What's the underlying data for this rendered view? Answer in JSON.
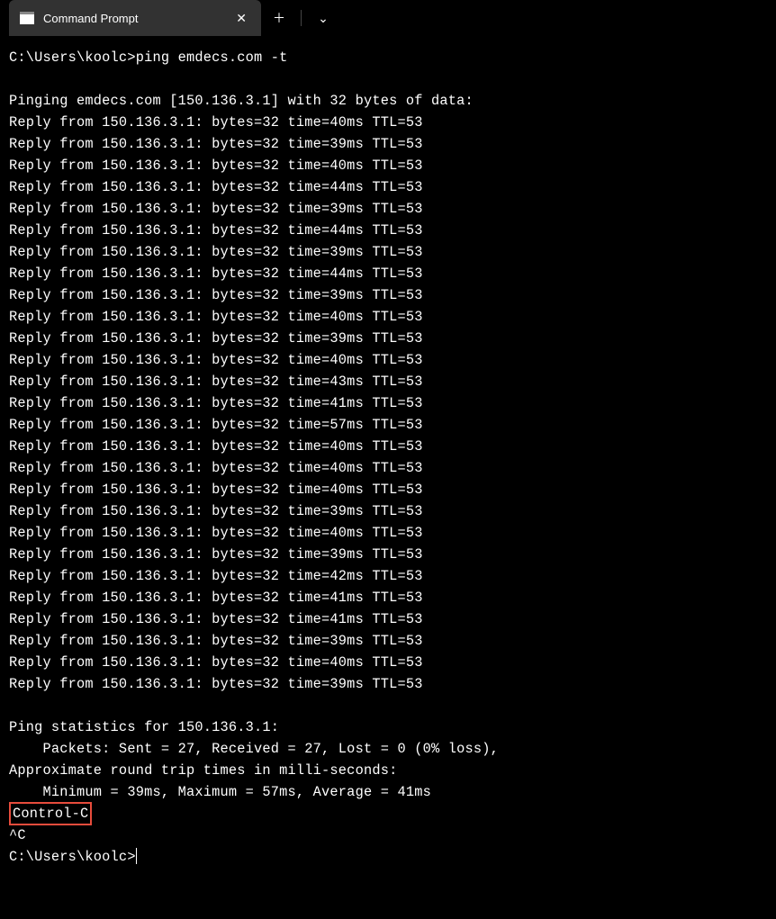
{
  "titlebar": {
    "tab_title": "Command Prompt",
    "close_label": "✕",
    "new_tab_label": "＋",
    "dropdown_label": "⌄"
  },
  "terminal": {
    "prompt1": "C:\\Users\\koolc>",
    "command1": "ping emdecs.com -t",
    "blank": "",
    "ping_header": "Pinging emdecs.com [150.136.3.1] with 32 bytes of data:",
    "replies": [
      "Reply from 150.136.3.1: bytes=32 time=40ms TTL=53",
      "Reply from 150.136.3.1: bytes=32 time=39ms TTL=53",
      "Reply from 150.136.3.1: bytes=32 time=40ms TTL=53",
      "Reply from 150.136.3.1: bytes=32 time=44ms TTL=53",
      "Reply from 150.136.3.1: bytes=32 time=39ms TTL=53",
      "Reply from 150.136.3.1: bytes=32 time=44ms TTL=53",
      "Reply from 150.136.3.1: bytes=32 time=39ms TTL=53",
      "Reply from 150.136.3.1: bytes=32 time=44ms TTL=53",
      "Reply from 150.136.3.1: bytes=32 time=39ms TTL=53",
      "Reply from 150.136.3.1: bytes=32 time=40ms TTL=53",
      "Reply from 150.136.3.1: bytes=32 time=39ms TTL=53",
      "Reply from 150.136.3.1: bytes=32 time=40ms TTL=53",
      "Reply from 150.136.3.1: bytes=32 time=43ms TTL=53",
      "Reply from 150.136.3.1: bytes=32 time=41ms TTL=53",
      "Reply from 150.136.3.1: bytes=32 time=57ms TTL=53",
      "Reply from 150.136.3.1: bytes=32 time=40ms TTL=53",
      "Reply from 150.136.3.1: bytes=32 time=40ms TTL=53",
      "Reply from 150.136.3.1: bytes=32 time=40ms TTL=53",
      "Reply from 150.136.3.1: bytes=32 time=39ms TTL=53",
      "Reply from 150.136.3.1: bytes=32 time=40ms TTL=53",
      "Reply from 150.136.3.1: bytes=32 time=39ms TTL=53",
      "Reply from 150.136.3.1: bytes=32 time=42ms TTL=53",
      "Reply from 150.136.3.1: bytes=32 time=41ms TTL=53",
      "Reply from 150.136.3.1: bytes=32 time=41ms TTL=53",
      "Reply from 150.136.3.1: bytes=32 time=39ms TTL=53",
      "Reply from 150.136.3.1: bytes=32 time=40ms TTL=53",
      "Reply from 150.136.3.1: bytes=32 time=39ms TTL=53"
    ],
    "stats_header": "Ping statistics for 150.136.3.1:",
    "packets": "    Packets: Sent = 27, Received = 27, Lost = 0 (0% loss),",
    "approx_header": "Approximate round trip times in milli-seconds:",
    "minmax": "    Minimum = 39ms, Maximum = 57ms, Average = 41ms",
    "control_c": "Control-C",
    "caret_c": "^C",
    "prompt2": "C:\\Users\\koolc>"
  }
}
